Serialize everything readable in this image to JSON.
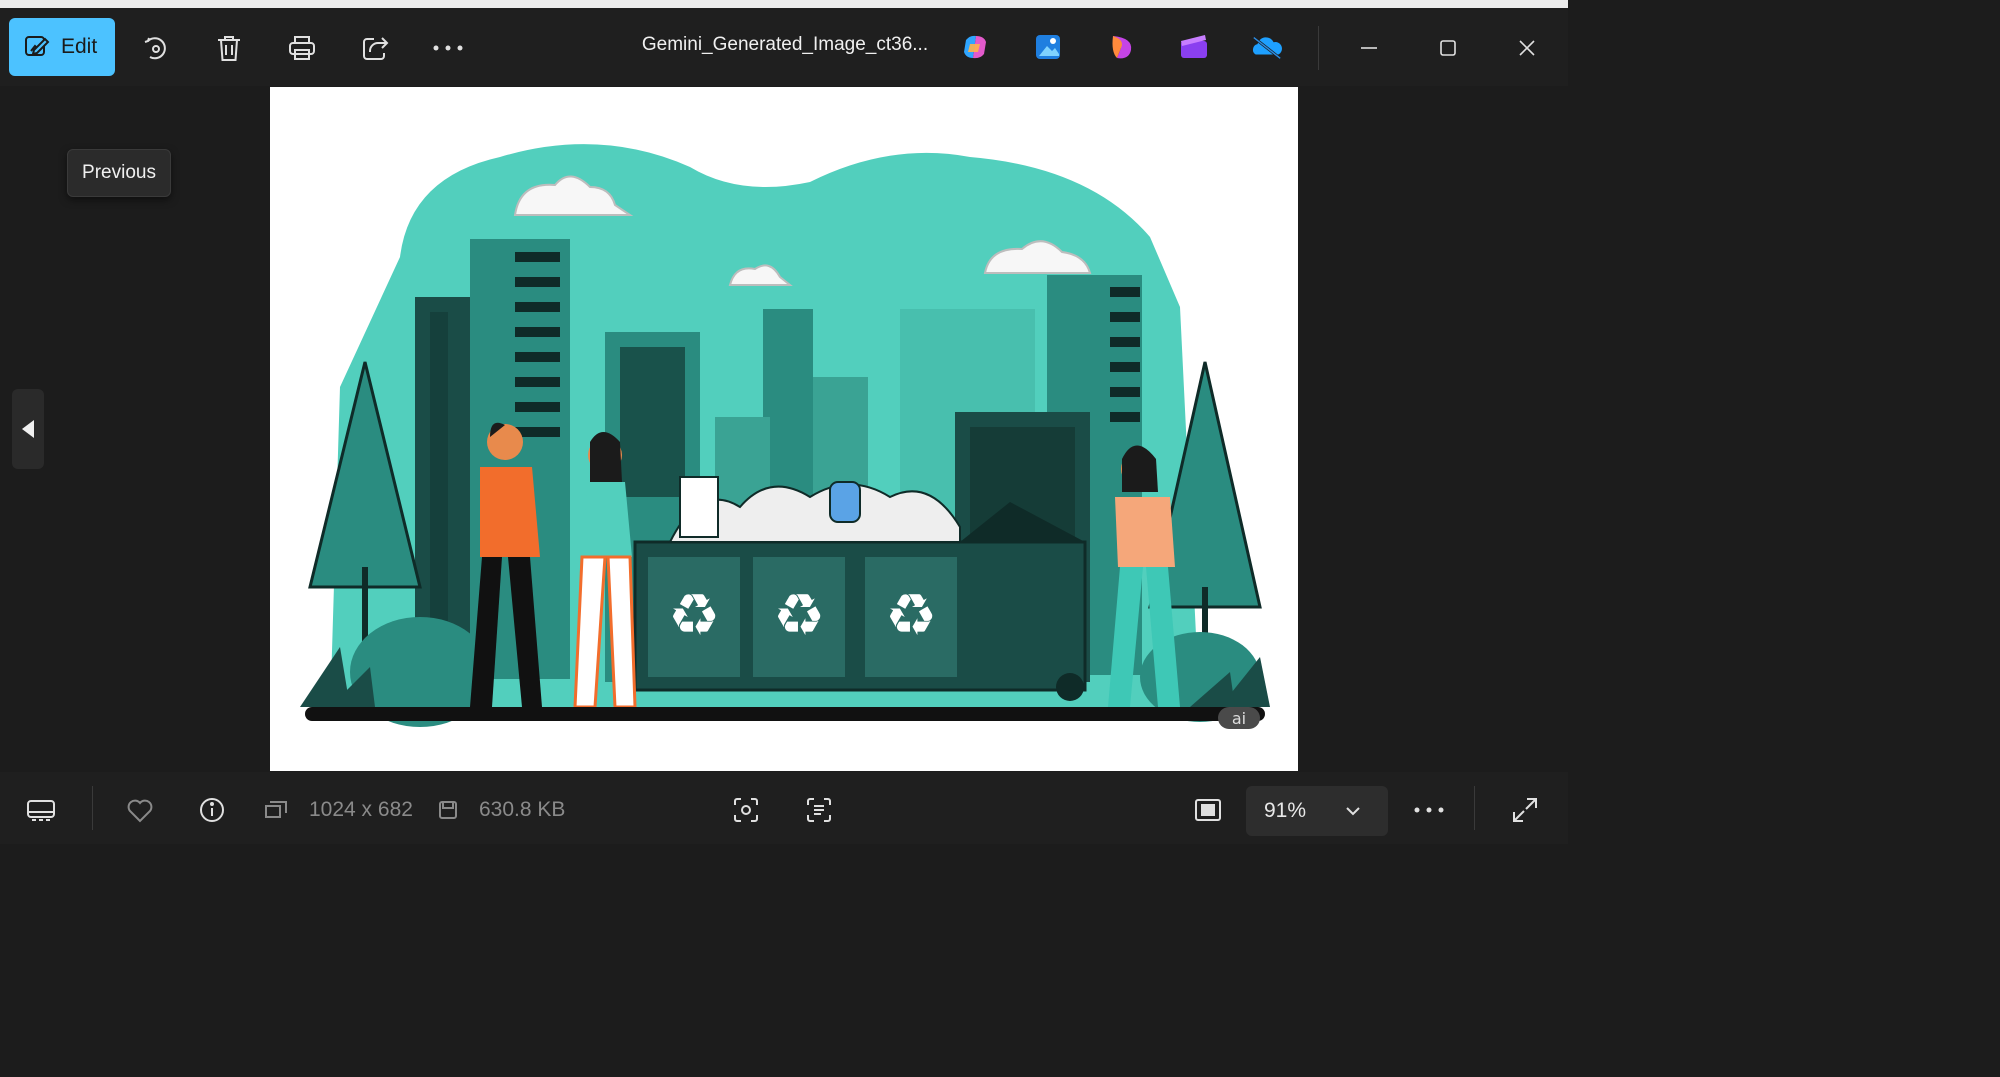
{
  "toolbar": {
    "edit_label": "Edit",
    "file_title": "Gemini_Generated_Image_ct36...",
    "icons": [
      "edit-icon",
      "rotate-icon",
      "delete-icon",
      "print-icon",
      "share-icon",
      "more-icon"
    ],
    "app_icons": [
      "copilot-icon",
      "photos-icon",
      "designer-icon",
      "clipchamp-icon",
      "onedrive-icon"
    ],
    "window_controls": [
      "minimize-icon",
      "maximize-icon",
      "close-icon"
    ]
  },
  "navigation": {
    "tooltip": "Previous"
  },
  "image": {
    "watermark": "ai"
  },
  "bottombar": {
    "dimensions": "1024 x 682",
    "file_size": "630.8 KB",
    "zoom": "91%"
  },
  "colors": {
    "accent": "#4cc2ff",
    "background": "#1c1c1c",
    "teal": "#4fd1c5",
    "dark_teal": "#1e6f66"
  }
}
